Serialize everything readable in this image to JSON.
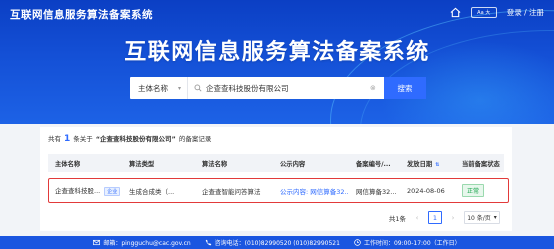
{
  "header": {
    "site_title": "互联网信息服务算法备案系统",
    "font_toggle": "Aa 大",
    "login_label": "登录 / 注册"
  },
  "hero": {
    "title": "互联网信息服务算法备案系统"
  },
  "search": {
    "type_label": "主体名称",
    "value": "企查查科技股份有限公司",
    "button_label": "搜索"
  },
  "results": {
    "summary_prefix": "共有",
    "count": "1",
    "summary_mid": "条关于",
    "query": "“企查查科技股份有限公司”",
    "summary_suffix": "的备案记录",
    "columns": [
      "主体名称",
      "算法类型",
      "算法名称",
      "公示内容",
      "备案编号/...",
      "发放日期",
      "当前备案状态"
    ],
    "sort_icon": "sort-icon",
    "rows": [
      {
        "entity": "企查查科技股...",
        "entity_tag": "企业",
        "algo_type": "生成合成类（...",
        "algo_name": "企查查智能问答算法",
        "publicity": "公示内容: 网信算备32...",
        "record_no": "网信算备32...",
        "date": "2024-08-06",
        "status": "正常"
      }
    ]
  },
  "pagination": {
    "total": "共1条",
    "prev": "‹",
    "current": "1",
    "next": "›",
    "page_size": "10 条/页"
  },
  "footer": {
    "email": "邮箱：pingguchu@cac.gov.cn",
    "phone": "咨询电话：(010)82990520   (010)82990521",
    "hours": "工作时间：09:00-17:00（工作日）"
  },
  "colors": {
    "brand_blue": "#1450d6",
    "accent": "#2f6bff",
    "highlight_border": "#e23a3a",
    "status_green": "#16a34a"
  }
}
